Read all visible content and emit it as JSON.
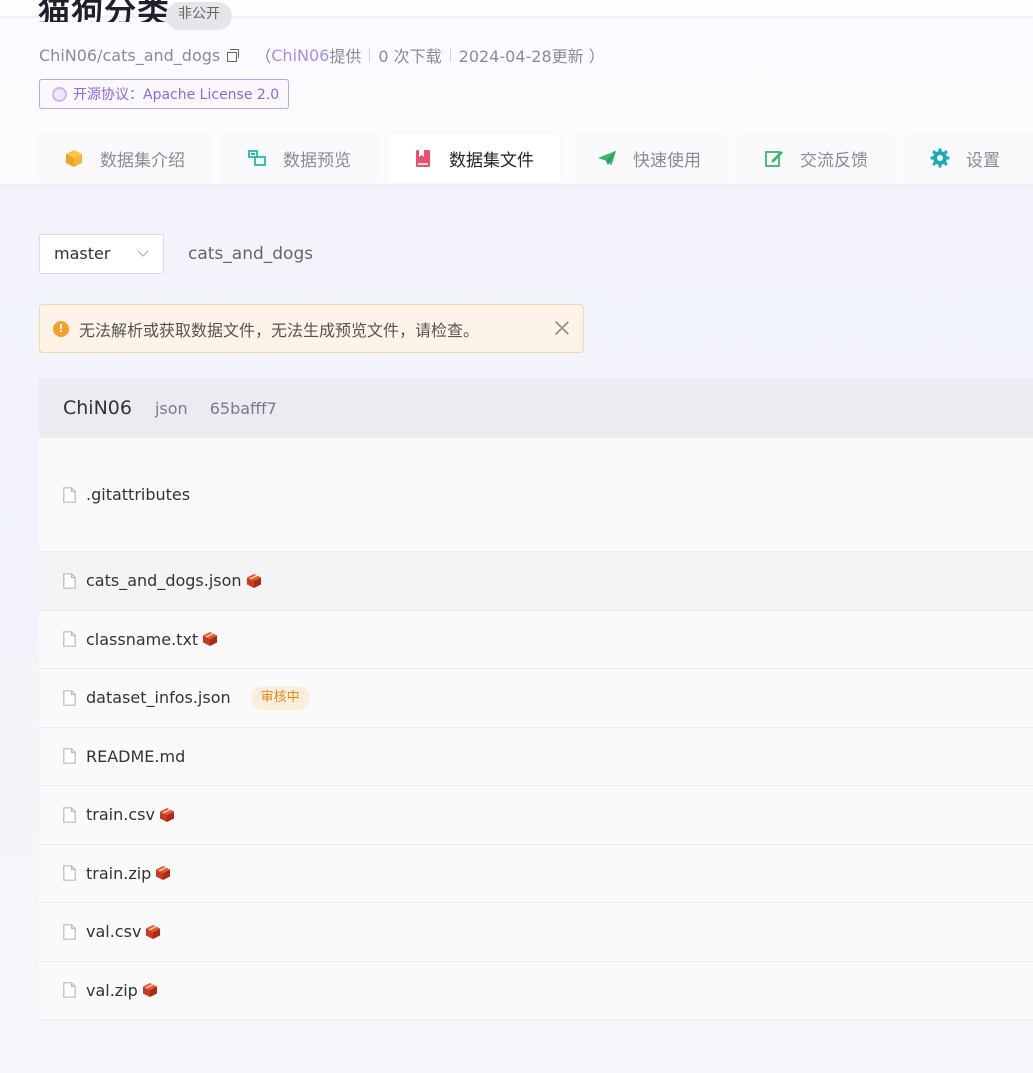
{
  "dataset": {
    "title": "猫狗分类",
    "visibility": "非公开",
    "repo_path": "ChiN06/cats_and_dogs",
    "meta_prefix": "（",
    "provider": "ChiN06",
    "provider_suffix": " 提供",
    "downloads": "0 次下载",
    "updated": "2024-04-28更新 ）",
    "license": "开源协议：Apache License 2.0"
  },
  "tabs": [
    {
      "label": "数据集介绍",
      "icon": "box-icon",
      "active": false
    },
    {
      "label": "数据预览",
      "icon": "preview-icon",
      "active": false
    },
    {
      "label": "数据集文件",
      "icon": "book-icon",
      "active": true
    },
    {
      "label": "快速使用",
      "icon": "paper-plane-icon",
      "active": false
    },
    {
      "label": "交流反馈",
      "icon": "edit-icon",
      "active": false
    },
    {
      "label": "设置",
      "icon": "gear-icon",
      "active": false
    }
  ],
  "branch": {
    "selected": "master"
  },
  "path": "cats_and_dogs",
  "alert": {
    "message": "无法解析或获取数据文件，无法生成预览文件，请检查。"
  },
  "commit": {
    "author": "ChiN06",
    "message": "json",
    "hash": "65bafff7"
  },
  "files": [
    {
      "name": ".gitattributes",
      "lfs": false,
      "badge": ""
    },
    {
      "name": "cats_and_dogs.json",
      "lfs": true,
      "badge": ""
    },
    {
      "name": "classname.txt",
      "lfs": true,
      "badge": ""
    },
    {
      "name": "dataset_infos.json",
      "lfs": false,
      "badge": "审核中"
    },
    {
      "name": "README.md",
      "lfs": false,
      "badge": ""
    },
    {
      "name": "train.csv",
      "lfs": true,
      "badge": ""
    },
    {
      "name": "train.zip",
      "lfs": true,
      "badge": ""
    },
    {
      "name": "val.csv",
      "lfs": true,
      "badge": ""
    },
    {
      "name": "val.zip",
      "lfs": true,
      "badge": ""
    }
  ],
  "colors": {
    "accent_purple": "#8c67e0",
    "active_tab_icon": "#e8506e",
    "warning": "#f3a12a",
    "review_badge_text": "#e08a1e"
  }
}
